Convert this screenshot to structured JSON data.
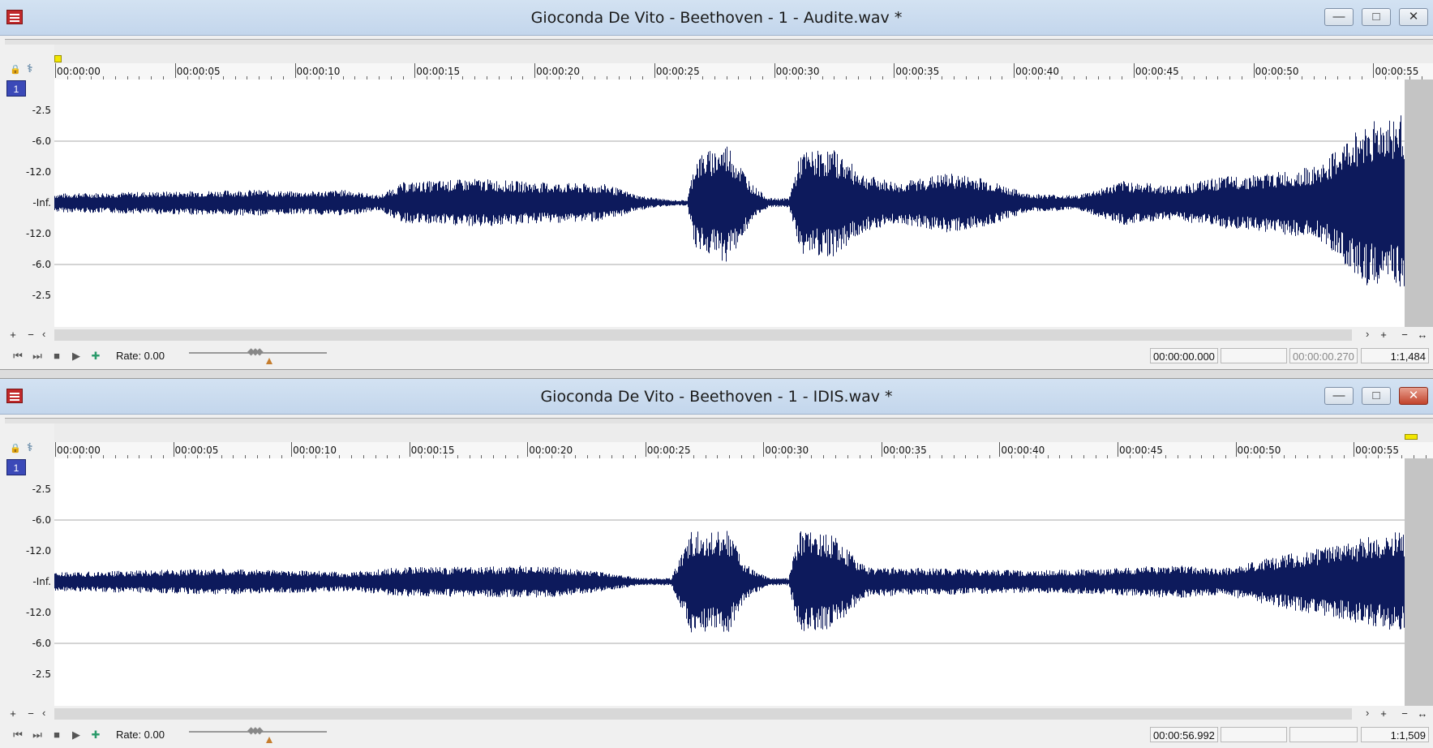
{
  "windows": [
    {
      "title": "Gioconda De Vito - Beethoven - 1 - Audite.wav *",
      "track_number": "1",
      "ruler_labels": [
        "00:00:00",
        "00:00:05",
        "00:00:10",
        "00:00:15",
        "00:00:20",
        "00:00:25",
        "00:00:30",
        "00:00:35",
        "00:00:40",
        "00:00:45",
        "00:00:50",
        "00:00:55"
      ],
      "db_labels": [
        "-2.5",
        "-6.0",
        "-12.0",
        "-Inf.",
        "-12.0",
        "-6.0",
        "-2.5"
      ],
      "rate": "Rate: 0.00",
      "selection_start": "00:00:00.000",
      "selection_end": "",
      "selection_length": "00:00:00.270",
      "zoom": "1:1,484",
      "marker": "start",
      "active": false
    },
    {
      "title": "Gioconda De Vito - Beethoven - 1 - IDIS.wav *",
      "track_number": "1",
      "ruler_labels": [
        "00:00:00",
        "00:00:05",
        "00:00:10",
        "00:00:15",
        "00:00:20",
        "00:00:25",
        "00:00:30",
        "00:00:35",
        "00:00:40",
        "00:00:45",
        "00:00:50",
        "00:00:55"
      ],
      "db_labels": [
        "-2.5",
        "-6.0",
        "-12.0",
        "-Inf.",
        "-12.0",
        "-6.0",
        "-2.5"
      ],
      "rate": "Rate: 0.00",
      "selection_start": "00:00:56.992",
      "selection_end": "",
      "selection_length": "",
      "zoom": "1:1,509",
      "marker": "end",
      "active": true
    }
  ],
  "icons": {
    "app": "sound-file-icon",
    "minimize": "minimize-icon",
    "maximize": "maximize-icon",
    "close": "close-icon",
    "lock": "lock-icon",
    "snap": "snap-icon",
    "go_start": "go-to-start-icon",
    "go_end": "go-to-end-icon",
    "stop": "stop-icon",
    "play": "play-icon",
    "loop": "loop-icon"
  },
  "colors": {
    "waveform": "#0d1a5c",
    "titlebar": "#c9dbef",
    "track_badge": "#3b49b8",
    "close_active": "#c2432c",
    "marker": "#f2e600"
  }
}
